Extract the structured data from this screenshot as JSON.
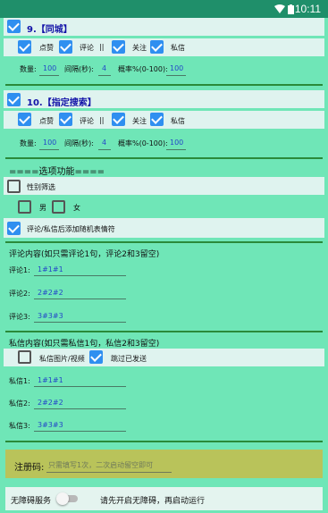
{
  "status_bar": {
    "time": "10:11",
    "wifi_icon": "wifi-icon",
    "battery_icon": "battery-icon"
  },
  "sections": [
    {
      "title": "9.【同城】",
      "checked": true,
      "options": {
        "like": "点赞",
        "comment": "评论",
        "sep": "||",
        "follow": "关注",
        "message": "私信"
      },
      "count_label": "数量:",
      "count_value": "100",
      "interval_label": "间隔(秒):",
      "interval_value": "4",
      "prob_label": "概率%(0-100):",
      "prob_value": "100"
    },
    {
      "title": "10.【指定搜索】",
      "checked": true,
      "options": {
        "like": "点赞",
        "comment": "评论",
        "sep": "||",
        "follow": "关注",
        "message": "私信"
      },
      "count_label": "数量:",
      "count_value": "100",
      "interval_label": "间隔(秒):",
      "interval_value": "4",
      "prob_label": "概率%(0-100):",
      "prob_value": "100"
    }
  ],
  "options_header": "====选项功能====",
  "gender_filter": "性别筛选",
  "male": "男",
  "female": "女",
  "emoji_option": "评论/私信后添加随机表情符",
  "comment_header": "评论内容(如只需评论1句，评论2和3留空)",
  "comments": [
    {
      "label": "评论1:",
      "value": "1#1#1"
    },
    {
      "label": "评论2:",
      "value": "2#2#2"
    },
    {
      "label": "评论3:",
      "value": "3#3#3"
    }
  ],
  "message_header": "私信内容(如只需私信1句，私信2和3留空)",
  "msg_media": "私信图片/视频",
  "skip_sent": "跳过已发送",
  "messages": [
    {
      "label": "私信1:",
      "value": "1#1#1"
    },
    {
      "label": "私信2:",
      "value": "2#2#2"
    },
    {
      "label": "私信3:",
      "value": "3#3#3"
    }
  ],
  "register_label": "注册码:",
  "register_placeholder": "只需填写1次，二次启动留空即可",
  "accessibility_label": "无障碍服务",
  "accessibility_hint": "请先开启无障碍，再启动运行"
}
